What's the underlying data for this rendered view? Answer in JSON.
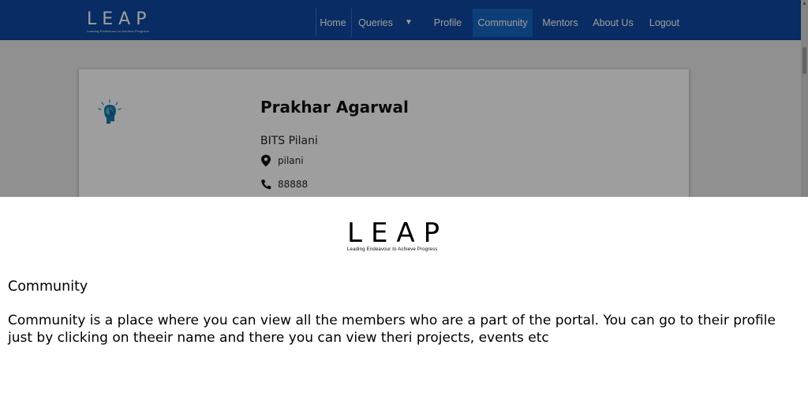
{
  "app": {
    "brand": {
      "word": "LEAP",
      "tagline": "Leading Endeavour to Achieve Progress"
    },
    "nav": {
      "items": [
        {
          "label": "Home"
        },
        {
          "label": "Queries"
        },
        {
          "label": "Profile"
        },
        {
          "label": "Community"
        },
        {
          "label": "Mentors"
        },
        {
          "label": "About Us"
        },
        {
          "label": "Logout"
        }
      ],
      "active": "Community",
      "dropdown_icon": "caret-down-icon"
    },
    "profile_card": {
      "avatar_icon": "lightbulb-head-icon",
      "name": "Prakhar Agarwal",
      "college": "BITS Pilani",
      "location": "pilani",
      "location_icon": "location-pin-icon",
      "phone": "88888",
      "phone_icon": "phone-icon"
    },
    "colors": {
      "navbar": "#0e47a1",
      "active_tab": "#1565c0"
    }
  },
  "help": {
    "logo": {
      "word": "LEAP",
      "tagline": "Leading Endeavour to Achieve Progress"
    },
    "heading": "Community",
    "body": "Community is a place where you can view all the members who are a part of the portal. You can go to their profile just by clicking on theeir name and there you can view theri projects, events etc"
  }
}
